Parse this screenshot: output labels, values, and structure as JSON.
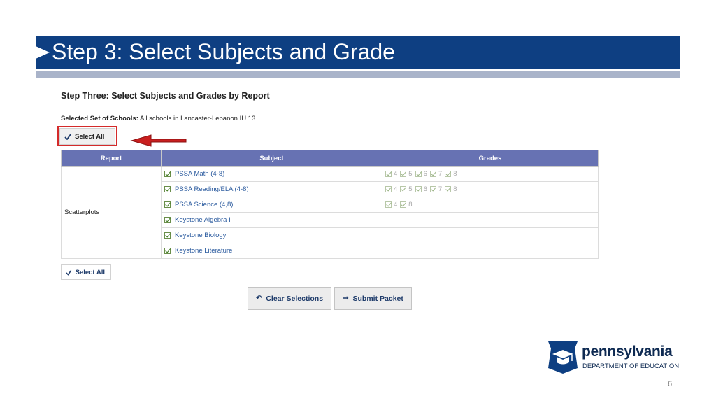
{
  "slide": {
    "title": "Step 3: Select Subjects and Grade",
    "page_number": "6"
  },
  "form": {
    "heading": "Step Three: Select Subjects and Grades by Report",
    "schools_label": "Selected Set of Schools:",
    "schools_value": " All schools in Lancaster-Lebanon IU 13",
    "select_all_top": "Select All",
    "select_all_bottom": "Select All",
    "clear_label": "Clear Selections",
    "submit_label": "Submit Packet"
  },
  "table": {
    "headers": [
      "Report",
      "Subject",
      "Grades"
    ],
    "report_name": "Scatterplots",
    "rows": [
      {
        "subject": "PSSA Math (4-8)",
        "grades": [
          "4",
          "5",
          "6",
          "7",
          "8"
        ]
      },
      {
        "subject": "PSSA Reading/ELA (4-8)",
        "grades": [
          "4",
          "5",
          "6",
          "7",
          "8"
        ]
      },
      {
        "subject": "PSSA Science (4,8)",
        "grades": [
          "4",
          "8"
        ]
      },
      {
        "subject": "Keystone Algebra I",
        "grades": []
      },
      {
        "subject": "Keystone Biology",
        "grades": []
      },
      {
        "subject": "Keystone Literature",
        "grades": []
      }
    ]
  },
  "logo": {
    "word": "pennsylvania",
    "dept": "DEPARTMENT OF EDUCATION"
  },
  "colors": {
    "title_bar": "#0e3f82",
    "table_header": "#6772b3",
    "highlight": "#d42a2a"
  },
  "icons": [
    "checkmark-icon",
    "undo-icon",
    "submit-icon",
    "red-arrow-icon",
    "keystone-cap-icon"
  ]
}
